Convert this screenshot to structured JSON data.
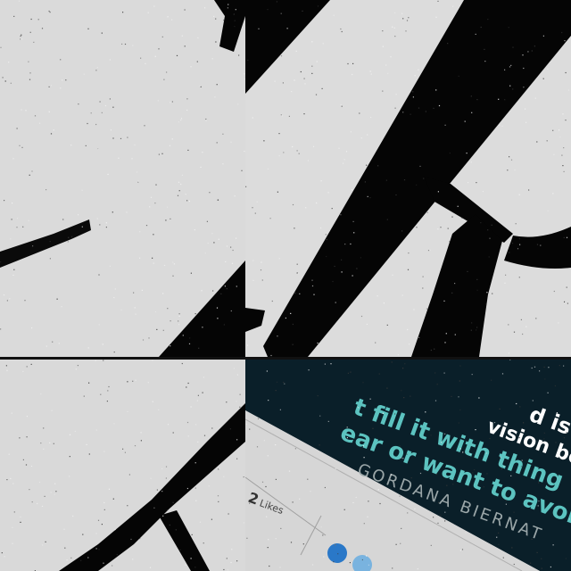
{
  "quote_card": {
    "lines": [
      "d is",
      "vision bo",
      "t fill it with thing",
      "ear or want to avoi"
    ],
    "author": "GORDANA BIERNAT",
    "background_color": "#0a1f29",
    "text_color": "#ffffff",
    "accent_text_color": "#5cc3c0"
  },
  "toolbar": {
    "likes_count": "2",
    "likes_label": "Likes"
  },
  "colors": {
    "canvas": "#dcdcdc",
    "ink": "#000000",
    "dot_primary": "#2a78c8",
    "dot_secondary": "#79b3df"
  }
}
